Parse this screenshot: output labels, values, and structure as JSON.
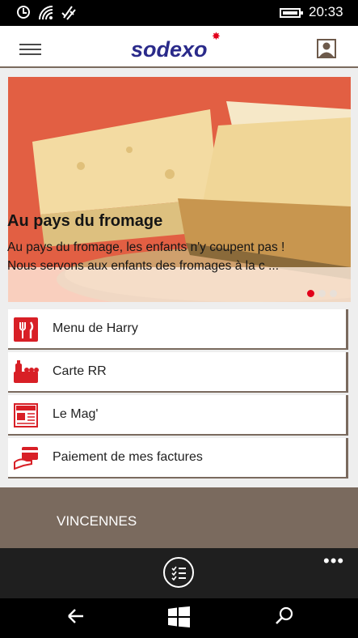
{
  "status_bar": {
    "time": "20:33"
  },
  "header": {
    "logo_text": "sodexo"
  },
  "banner": {
    "title": "Au pays du fromage",
    "description_line1": "Au pays du fromage, les enfants n'y coupent pas !",
    "description_line2": "Nous servons aux enfants des fromages à la c ...",
    "carousel": {
      "count": 3,
      "active_index": 0,
      "active_color": "#e2001a",
      "inactive_color": "#e8e0d8"
    }
  },
  "menu": {
    "items": [
      {
        "label": "Menu de Harry",
        "icon": "menu-cutlery-icon"
      },
      {
        "label": "Carte RR",
        "icon": "food-card-icon"
      },
      {
        "label": "Le Mag'",
        "icon": "magazine-icon"
      },
      {
        "label": "Paiement de mes factures",
        "icon": "payment-card-icon"
      }
    ]
  },
  "location": {
    "name": "VINCENNES"
  },
  "app_bar": {
    "more_label": "•••"
  },
  "colors": {
    "brand_blue": "#2a2a8a",
    "brand_red": "#e2001a",
    "accent_brown": "#7a6a5e",
    "banner_red": "#e25f43"
  }
}
